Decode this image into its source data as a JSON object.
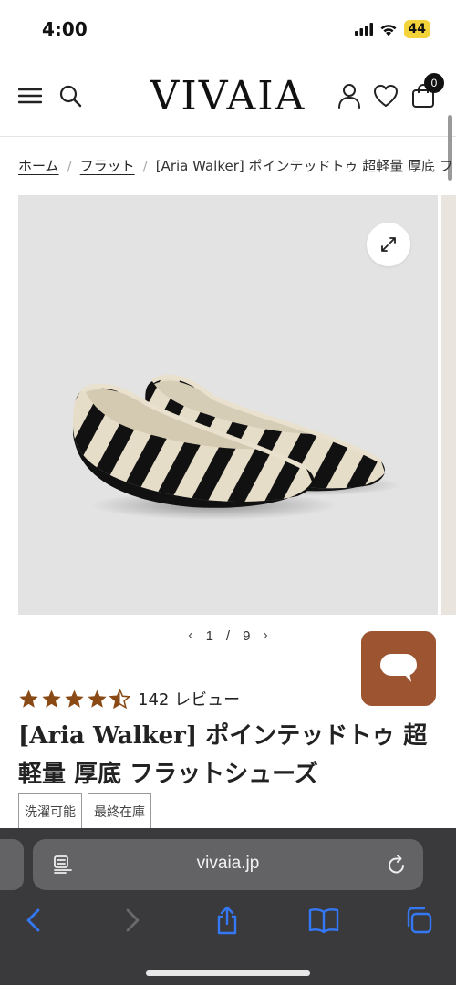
{
  "status_bar": {
    "time": "4:00",
    "battery": "44"
  },
  "header": {
    "logo": "VIVAIA",
    "cart_count": "0"
  },
  "breadcrumb": [
    {
      "label": "ホーム"
    },
    {
      "label": "フラット"
    },
    {
      "label": "[Aria Walker] ポインテッドトゥ 超軽量 厚底 フ"
    }
  ],
  "gallery": {
    "current": "1",
    "total": "9",
    "separator": "/"
  },
  "product": {
    "rating": 4.5,
    "review_count": "142 レビュー",
    "title": "[Aria Walker] ポインテッドトゥ 超軽量 厚底 フラットシューズ",
    "tags": [
      "洗濯可能",
      "最終在庫"
    ]
  },
  "browser": {
    "url": "vivaia.jp"
  },
  "colors": {
    "chat_button": "#9c5431",
    "star": "#8a4a16",
    "toolbar": "#3a3a3c",
    "accent_blue": "#3478f6"
  },
  "icons": {
    "menu": "hamburger-icon",
    "search": "search-icon",
    "account": "user-icon",
    "wishlist": "heart-icon",
    "cart": "bag-icon",
    "expand": "expand-icon",
    "chat": "chat-bubble-icon",
    "reader": "reader-icon",
    "reload": "reload-icon",
    "back": "chevron-left-icon",
    "forward": "chevron-right-icon",
    "share": "share-icon",
    "bookmarks": "book-icon",
    "tabs": "tabs-icon"
  }
}
